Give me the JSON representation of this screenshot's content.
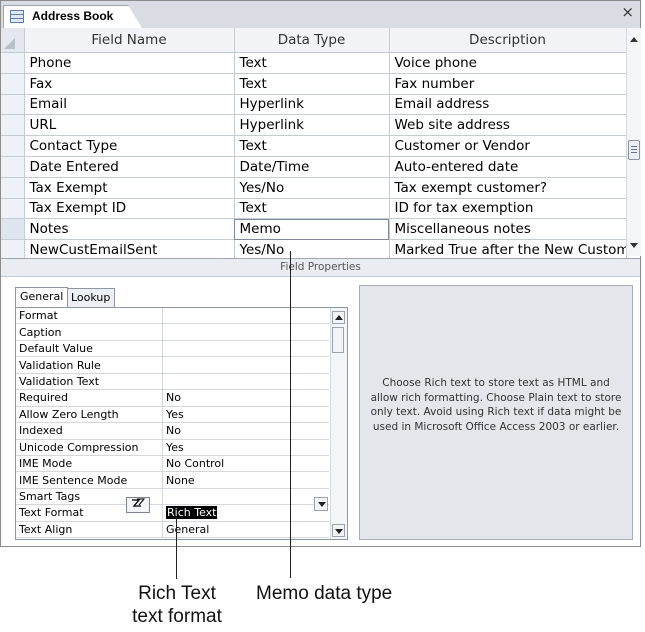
{
  "tab": {
    "title": "Address Book",
    "close": "×",
    "icon": "table-icon"
  },
  "grid": {
    "headers": [
      "Field Name",
      "Data Type",
      "Description"
    ],
    "rows": [
      {
        "name": "Phone",
        "type": "Text",
        "desc": "Voice phone"
      },
      {
        "name": "Fax",
        "type": "Text",
        "desc": "Fax number"
      },
      {
        "name": "Email",
        "type": "Hyperlink",
        "desc": "Email address"
      },
      {
        "name": "URL",
        "type": "Hyperlink",
        "desc": "Web site address"
      },
      {
        "name": "Contact Type",
        "type": "Text",
        "desc": "Customer or Vendor"
      },
      {
        "name": "Date Entered",
        "type": "Date/Time",
        "desc": "Auto-entered date"
      },
      {
        "name": "Tax Exempt",
        "type": "Yes/No",
        "desc": "Tax exempt customer?"
      },
      {
        "name": "Tax Exempt ID",
        "type": "Text",
        "desc": "ID for tax exemption"
      },
      {
        "name": "Notes",
        "type": "Memo",
        "desc": "Miscellaneous notes"
      },
      {
        "name": "NewCustEmailSent",
        "type": "Yes/No",
        "desc": "Marked True after the New Custom"
      }
    ],
    "current_row": "Notes"
  },
  "field_properties_label": "Field Properties",
  "property_tabs": {
    "general": "General",
    "lookup": "Lookup"
  },
  "properties": [
    {
      "name": "Format",
      "value": ""
    },
    {
      "name": "Caption",
      "value": ""
    },
    {
      "name": "Default Value",
      "value": ""
    },
    {
      "name": "Validation Rule",
      "value": ""
    },
    {
      "name": "Validation Text",
      "value": ""
    },
    {
      "name": "Required",
      "value": "No"
    },
    {
      "name": "Allow Zero Length",
      "value": "Yes"
    },
    {
      "name": "Indexed",
      "value": "No"
    },
    {
      "name": "Unicode Compression",
      "value": "Yes"
    },
    {
      "name": "IME Mode",
      "value": "No Control"
    },
    {
      "name": "IME Sentence Mode",
      "value": "None"
    },
    {
      "name": "Smart Tags",
      "value": ""
    },
    {
      "name": "Text Format",
      "value": "Rich Text"
    },
    {
      "name": "Text Align",
      "value": "General"
    }
  ],
  "help_text": "Choose Rich text to store text as HTML and allow rich formatting. Choose Plain text to store only text. Avoid using Rich text if data might be used in Microsoft Office Access 2003 or earlier.",
  "callouts": {
    "rich_text": [
      "Rich Text",
      "text format"
    ],
    "memo": "Memo data type"
  }
}
